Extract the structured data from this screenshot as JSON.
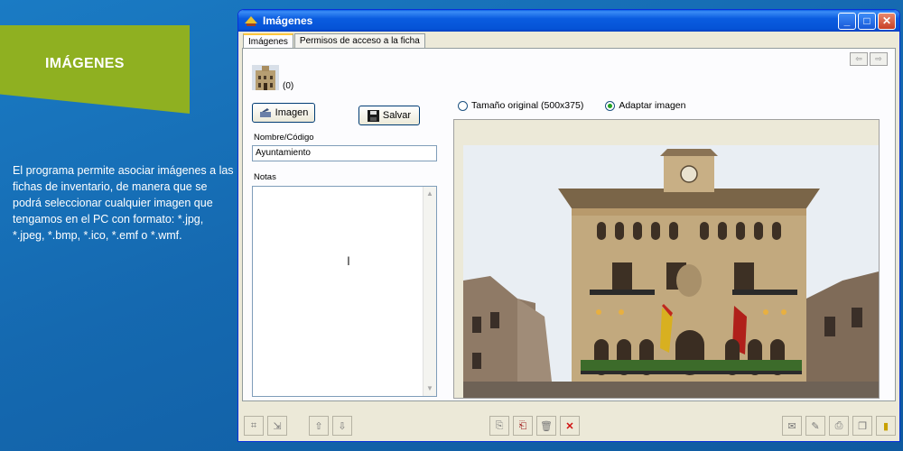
{
  "promo": {
    "title": "IMÁGENES",
    "description": "El programa permite asociar imágenes a las fichas de inventario, de manera que se podrá seleccionar cualquier imagen que tengamos en el PC con formato: *.jpg, *.jpeg, *.bmp, *.ico, *.emf o *.wmf."
  },
  "window": {
    "title": "Imágenes",
    "controls": {
      "minimize": "_",
      "maximize": "□",
      "close": "✕"
    }
  },
  "tabs": [
    {
      "label": "Imágenes",
      "active": true
    },
    {
      "label": "Permisos de acceso a la ficha",
      "active": false
    }
  ],
  "panel": {
    "thumb_number": "(0)",
    "imagen_button": "Imagen",
    "salvar_button": "Salvar",
    "name_label": "Nombre/Código",
    "name_value": "Ayuntamiento",
    "notes_label": "Notas",
    "radio_original": "Tamaño original (500x375)",
    "radio_adapt": "Adaptar imagen"
  },
  "colors": {
    "accent_green": "#8fb021",
    "background_blue": "#1569b0",
    "xp_blue": "#0553d6"
  },
  "icons": {
    "nav_prev": "⇦",
    "nav_next": "⇨"
  }
}
